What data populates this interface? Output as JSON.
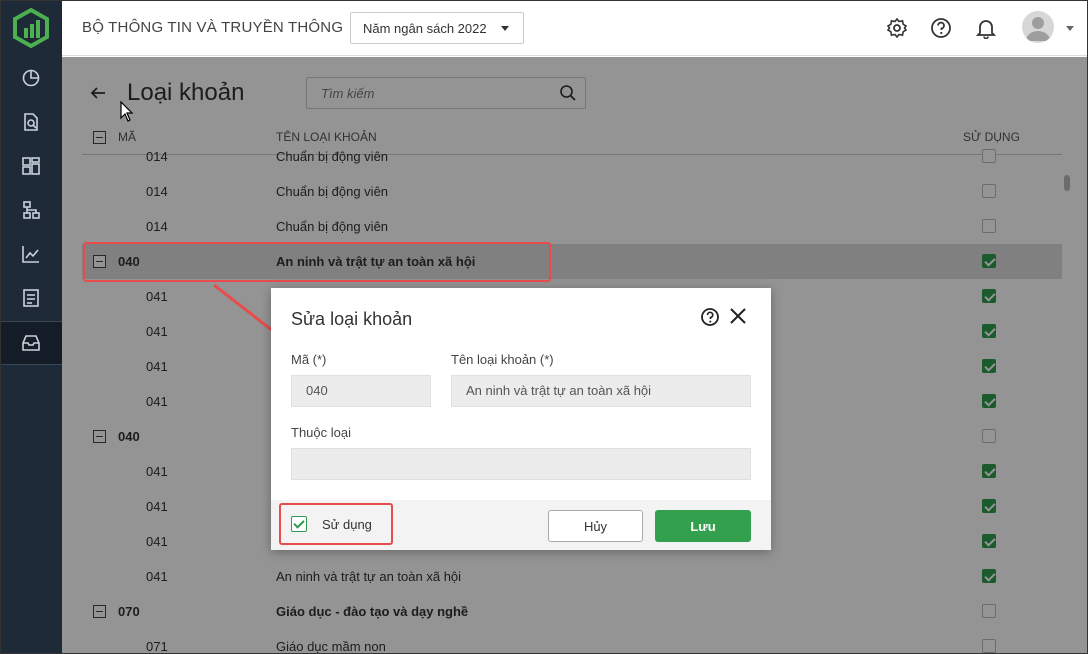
{
  "header": {
    "org_title": "BỘ THÔNG TIN VÀ TRUYỀN THÔNG",
    "year_select": "Năm ngân sách 2022"
  },
  "page": {
    "title": "Loại khoản",
    "search_placeholder": "Tìm kiếm"
  },
  "grid": {
    "col_code": "MÃ",
    "col_name": "TÊN LOẠI KHOẢN",
    "col_use": "SỬ DỤNG",
    "rows": [
      {
        "code": "014",
        "name": "Chuẩn bị động viên",
        "used": false
      },
      {
        "code": "014",
        "name": "Chuẩn bị động viên",
        "used": false
      },
      {
        "code": "014",
        "name": "Chuẩn bị động viên",
        "used": false
      },
      {
        "code": "040",
        "name": "An ninh và trật tự an toàn xã hội",
        "used": true
      },
      {
        "code": "041",
        "name": "",
        "used": true
      },
      {
        "code": "041",
        "name": "",
        "used": true
      },
      {
        "code": "041",
        "name": "",
        "used": true
      },
      {
        "code": "041",
        "name": "",
        "used": true
      },
      {
        "code": "040",
        "name": "",
        "used": false
      },
      {
        "code": "041",
        "name": "",
        "used": true
      },
      {
        "code": "041",
        "name": "",
        "used": true
      },
      {
        "code": "041",
        "name": "",
        "used": true
      },
      {
        "code": "041",
        "name": "An ninh và trật tự an toàn xã hội",
        "used": true
      },
      {
        "code": "070",
        "name": "Giáo dục - đào tạo và dạy nghề",
        "used": false
      },
      {
        "code": "071",
        "name": "Giáo dục mầm non",
        "used": false
      }
    ]
  },
  "modal": {
    "title": "Sửa loại khoản",
    "code_label": "Mã (*)",
    "code_value": "040",
    "name_label": "Tên loại khoản (*)",
    "name_value": "An ninh và trật tự an toàn xã hội",
    "parent_label": "Thuộc loại",
    "parent_value": "",
    "use_label": "Sử dụng",
    "use_checked": true,
    "cancel_label": "Hủy",
    "save_label": "Lưu"
  },
  "colors": {
    "sidebar": "#1e2a38",
    "accent_green": "#33a04e",
    "highlight_red": "#e84c4c"
  },
  "icons": {
    "sidebar": [
      "dashboard-chart-icon",
      "document-search-icon",
      "grid-icon",
      "hierarchy-icon",
      "line-chart-icon",
      "report-icon",
      "inbox-icon"
    ],
    "header": [
      "gear-icon",
      "help-icon",
      "bell-icon",
      "avatar-icon"
    ]
  }
}
